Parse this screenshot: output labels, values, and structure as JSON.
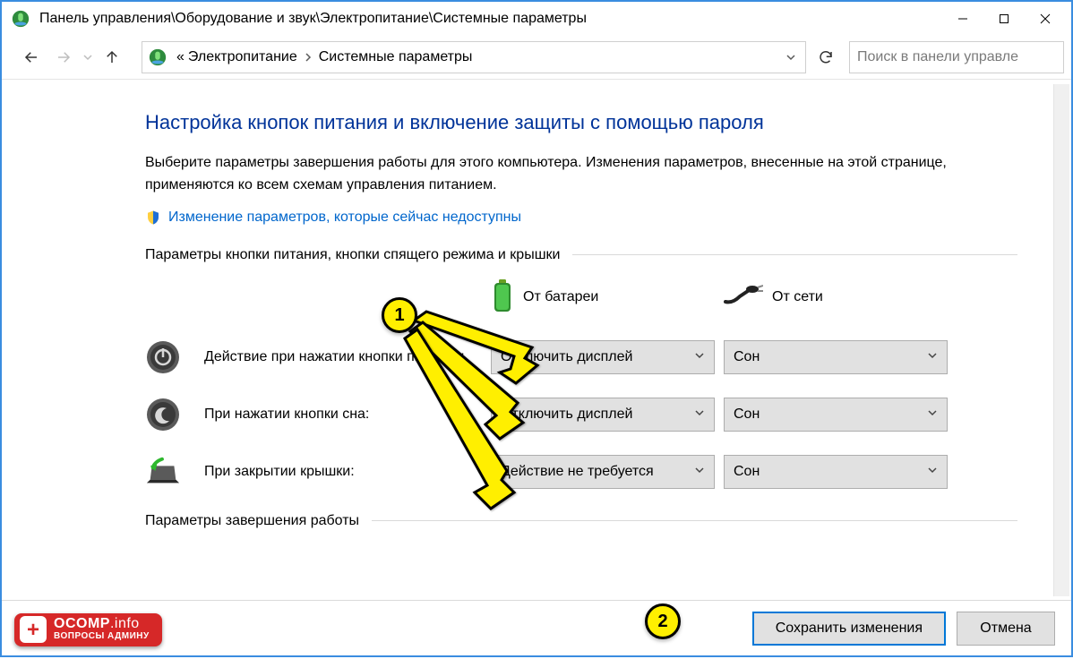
{
  "title": "Панель управления\\Оборудование и звук\\Электропитание\\Системные параметры",
  "breadcrumb": {
    "prefix": "«",
    "items": [
      "Электропитание",
      "Системные параметры"
    ]
  },
  "search": {
    "placeholder": "Поиск в панели управле"
  },
  "heading": "Настройка кнопок питания и включение защиты с помощью пароля",
  "description": "Выберите параметры завершения работы для этого компьютера. Изменения параметров, внесенные на этой странице, применяются ко всем схемам управления питанием.",
  "unlock_link": "Изменение параметров, которые сейчас недоступны",
  "group1_title": "Параметры кнопки питания, кнопки спящего режима и крышки",
  "columns": {
    "battery": "От батареи",
    "ac": "От сети"
  },
  "rows": [
    {
      "label": "Действие при нажатии кнопки питания:",
      "battery": "Отключить дисплей",
      "ac": "Сон"
    },
    {
      "label": "При нажатии кнопки сна:",
      "battery": "Отключить дисплей",
      "ac": "Сон"
    },
    {
      "label": "При закрытии крышки:",
      "battery": "Действие не требуется",
      "ac": "Сон"
    }
  ],
  "group2_title": "Параметры завершения работы",
  "footer": {
    "save": "Сохранить изменения",
    "cancel": "Отмена"
  },
  "annotations": {
    "n1": "1",
    "n2": "2"
  },
  "badge": {
    "line1a": "OCOMP",
    "line1b": ".info",
    "line2": "ВОПРОСЫ АДМИНУ"
  }
}
